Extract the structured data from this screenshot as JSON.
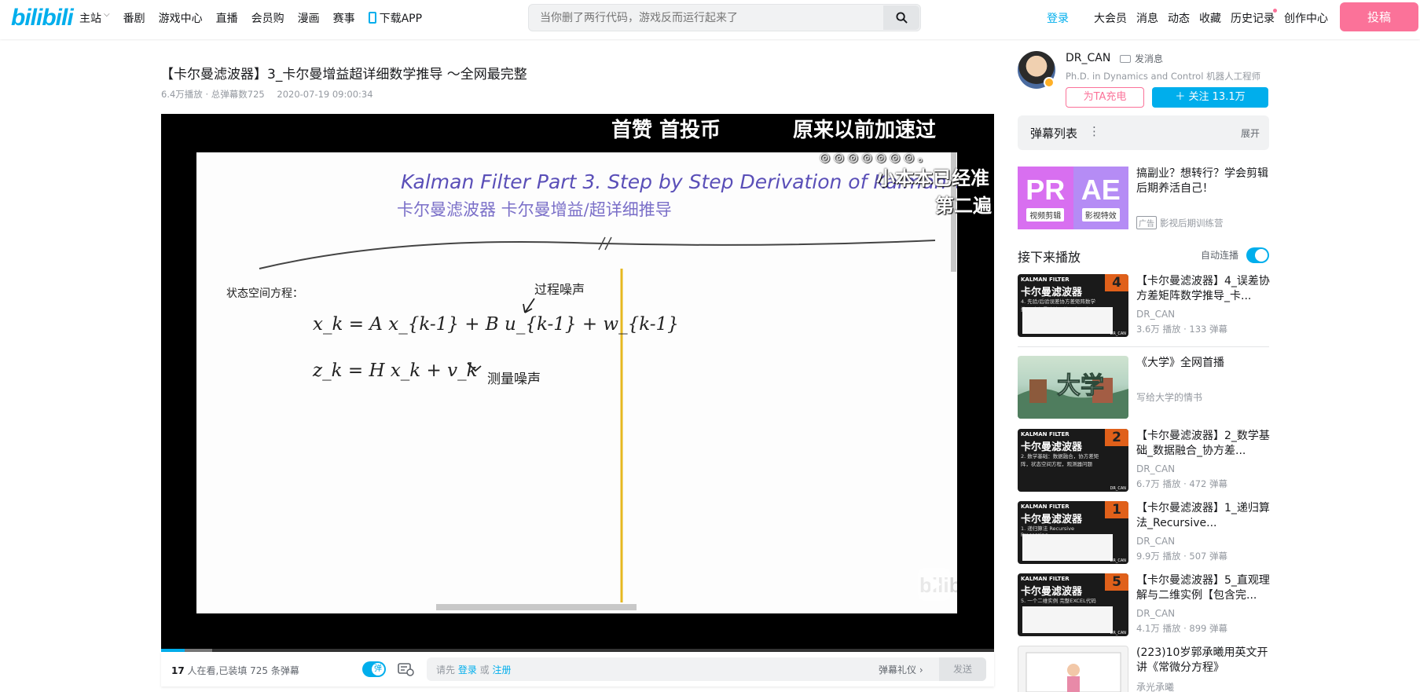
{
  "header": {
    "logo": "bilibili",
    "nav": [
      "主站",
      "番剧",
      "游戏中心",
      "直播",
      "会员购",
      "漫画",
      "赛事"
    ],
    "download_app": "下载APP",
    "search_placeholder": "当你删了两行代码，游戏反而运行起来了",
    "login": "登录",
    "right_links": [
      "大会员",
      "消息",
      "动态",
      "收藏",
      "历史记录",
      "创作中心"
    ],
    "upload": "投稿"
  },
  "video": {
    "title": "【卡尔曼滤波器】3_卡尔曼增益超详细数学推导 ～全网最完整",
    "plays": "6.4万播放",
    "danmaku_total": "· 总弹幕数725",
    "date": "2020-07-19 09:00:34"
  },
  "player": {
    "danmaku": [
      "首赞 首投币",
      "原来以前加速过",
      "小本本已经准",
      "第二遍",
      "◎ ◎ ◎ ◎ ◎ ◎ ◎ 。"
    ],
    "board_title": "Kalman Filter   Part 3. Step by Step Derivation of Kalman Gain",
    "board_subtitle": "卡尔曼滤波器      卡尔曼增益/超详细推导",
    "board_state_label": "状态空间方程：",
    "board_eq1": "x_k = A x_{k-1} + B u_{k-1} + w_{k-1}",
    "board_eq2": "z_k = H x_k + v_k",
    "board_note1": "过程噪声",
    "board_note2": "测量噪声",
    "watermark": "bilibili"
  },
  "controls": {
    "viewers_count": "17",
    "viewers_text": " 人在看,已装填 725 条弹幕",
    "dm_toggle": "弹",
    "input_prefix": "请先 ",
    "input_login": "登录",
    "input_or": " 或 ",
    "input_register": "注册",
    "etiquette": "弹幕礼仪 ›",
    "send": "发送"
  },
  "uploader": {
    "name": "DR_CAN",
    "message": "发消息",
    "desc": "Ph.D. in Dynamics and Control 机器人工程师",
    "charge": "为TA充电",
    "follow": "＋  关注 13.1万"
  },
  "danmaku_list": {
    "title": "弹幕列表",
    "menu": "⋮",
    "expand": "展开"
  },
  "ad": {
    "pr": "PR",
    "pr_label": "视频剪辑",
    "ae": "AE",
    "ae_label": "影视特效",
    "title": "搞副业？想转行？学会剪辑后期养活自己！",
    "tag": "广告",
    "source": "影视后期训练营"
  },
  "next_up": {
    "title": "接下来播放",
    "autoplay": "自动连播"
  },
  "recommendations": [
    {
      "title": "【卡尔曼滤波器】4_误差协方差矩阵数学推导_卡...",
      "up": "DR_CAN",
      "stats": "3.6万 播放 · 133 弹幕",
      "num": "4",
      "sub": "4. 先验/后验误差协方差矩阵数学推导 卡尔曼滤波器的五个公式"
    },
    {
      "title": "《大学》全网首播",
      "up": "写给大学的情书",
      "stats": ""
    },
    {
      "title": "【卡尔曼滤波器】2_数学基础_数据融合_协方差...",
      "up": "DR_CAN",
      "stats": "6.7万 播放 · 472 弹幕",
      "num": "2",
      "sub": "2. 数学基础：数据融合，协方差矩阵，状态空间方程，观测器问题"
    },
    {
      "title": "【卡尔曼滤波器】1_递归算法_Recursive...",
      "up": "DR_CAN",
      "stats": "9.9万 播放 · 507 弹幕",
      "num": "1",
      "sub": "1. 递归算法 Recursive Processing"
    },
    {
      "title": "【卡尔曼滤波器】5_直观理解与二维实例【包含完...",
      "up": "DR_CAN",
      "stats": "4.1万 播放 · 899 弹幕",
      "num": "5",
      "sub": "5. 一个二维实例 完整EXCEL代码"
    },
    {
      "title": "(223)10岁郭承曦用英文开讲《常微分方程》",
      "up": "承光承曦",
      "stats": ""
    }
  ],
  "thumb_brand": "KALMAN FILTER",
  "thumb_cn": "卡尔曼滤波器",
  "thumb_author": "DR_CAN",
  "univ_thumb_text": "大学"
}
